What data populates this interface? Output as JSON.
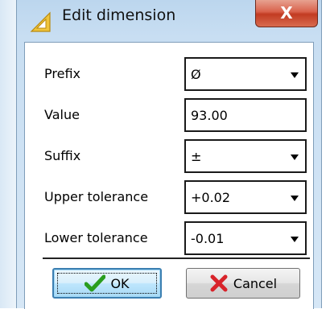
{
  "window": {
    "title": "Edit dimension",
    "close_label": "X"
  },
  "form": {
    "prefix": {
      "label": "Prefix",
      "value": "Ø"
    },
    "value": {
      "label": "Value",
      "value": "93.00"
    },
    "suffix": {
      "label": "Suffix",
      "value": "±"
    },
    "upper_tolerance": {
      "label": "Upper tolerance",
      "value": "+0.02"
    },
    "lower_tolerance": {
      "label": "Lower tolerance",
      "value": "-0.01"
    }
  },
  "buttons": {
    "ok_label": "OK",
    "cancel_label": "Cancel"
  },
  "icons": {
    "title": "warning-triangle-icon",
    "ok": "checkmark-icon",
    "cancel": "red-x-icon",
    "dropdown": "dropdown-arrow-icon"
  },
  "colors": {
    "title_bar": "#c8def2",
    "close_button": "#c23b22",
    "ok_check": "#2a9d1e",
    "cancel_x": "#d8232a",
    "focus_border": "#3c7fb1"
  }
}
